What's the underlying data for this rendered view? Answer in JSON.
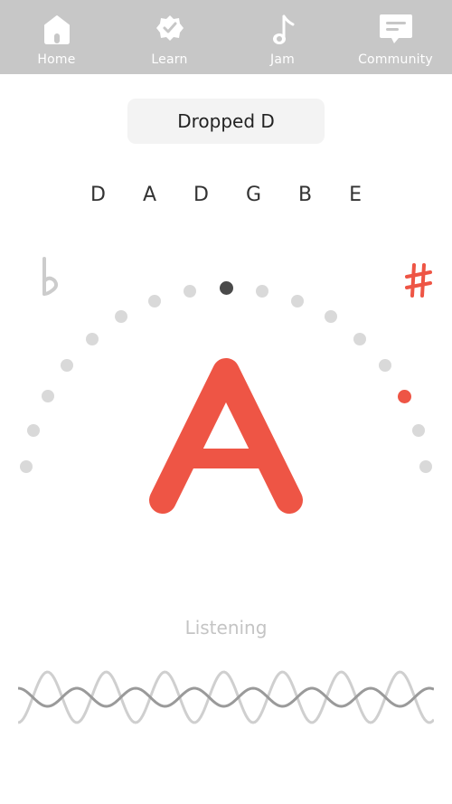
{
  "nav": {
    "items": [
      {
        "label": "Home",
        "icon": "home-icon"
      },
      {
        "label": "Learn",
        "icon": "badge-check-icon"
      },
      {
        "label": "Jam",
        "icon": "music-note-icon"
      },
      {
        "label": "Community",
        "icon": "chat-icon"
      }
    ]
  },
  "tuning": {
    "name": "Dropped D",
    "strings": "D A D G B E"
  },
  "tuner": {
    "note": "A",
    "flat_icon": "flat-icon",
    "sharp_icon": "sharp-icon",
    "status": "Listening"
  },
  "colors": {
    "accent": "#ee5545",
    "navbar": "#c7c7c7",
    "dot_inactive": "#d9d9d9",
    "dot_center": "#4a4a4a"
  }
}
